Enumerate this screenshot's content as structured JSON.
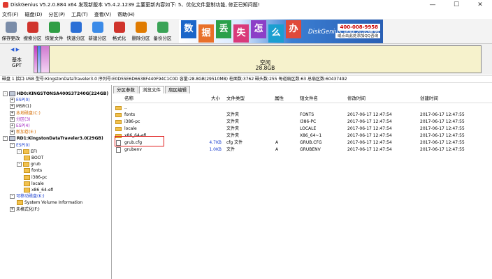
{
  "window": {
    "title": "DiskGenius V5.2.0.884 x64   发现新版本 V5.4.2.1239 主要更新内容如下: 5、优化文件复制功能, 修正已知问题!",
    "min": "—",
    "max": "☐",
    "close": "✕"
  },
  "menu": [
    "文件(F)",
    "磁盘(D)",
    "分区(P)",
    "工具(T)",
    "查看(V)",
    "帮助(H)"
  ],
  "toolbar": [
    {
      "label": "保存更改",
      "icon": "save-icon",
      "color": "#7a8ca8"
    },
    {
      "label": "搜索分区",
      "icon": "search-partition-icon",
      "color": "#d0342c"
    },
    {
      "label": "恢复文件",
      "icon": "recover-file-icon",
      "color": "#2f9e44"
    },
    {
      "label": "快速分区",
      "icon": "quick-partition-icon",
      "color": "#2b6fd6"
    },
    {
      "label": "新建分区",
      "icon": "new-partition-icon",
      "color": "#3b8be8"
    },
    {
      "label": "格式化",
      "icon": "format-icon",
      "color": "#d0342c"
    },
    {
      "label": "删除分区",
      "icon": "delete-partition-icon",
      "color": "#e07b00"
    },
    {
      "label": "备份分区",
      "icon": "backup-partition-icon",
      "color": "#3aa356"
    }
  ],
  "banner": {
    "chars": [
      "数",
      "据",
      "丢",
      "失",
      "怎",
      "么",
      "办"
    ],
    "colors": [
      "#1b66c9",
      "#e8702a",
      "#2aa04a",
      "#d93a7a",
      "#8c3fc7",
      "#1b9fd0",
      "#e04a3a"
    ],
    "slogan": "DiskGenius 团队为您服务",
    "phone": "400-008-9958",
    "qq": "或点击此处添加QQ咨询"
  },
  "disk": {
    "basic": "基本",
    "gpt": "GPT",
    "free_label": "空闲",
    "free_size": "28.8GB"
  },
  "infobar": "磁盘 1 接口:USB  型号:KingstonDataTraveler3.0  序列号:E0D55E6D6638F440F94C1C0D  容量:28.8GB(29510MB)  柱面数:3762  磁头数:255  每道扇区数:63  总扇区数:60437492",
  "tree": [
    {
      "label": "HD0:KINGSTONSA400S37240G(224GB)",
      "cls": "bold",
      "exp": "-",
      "icon": "disk",
      "indent": 0
    },
    {
      "label": "ESP(0)",
      "cls": "blue",
      "exp": "+",
      "icon": "none",
      "indent": 1
    },
    {
      "label": "MSR(1)",
      "cls": "",
      "exp": "+",
      "icon": "none",
      "indent": 1
    },
    {
      "label": "本地磁盘(C:)",
      "cls": "orange",
      "exp": "+",
      "icon": "none",
      "indent": 1
    },
    {
      "label": "分区(3)",
      "cls": "purple",
      "exp": "+",
      "icon": "none",
      "indent": 1
    },
    {
      "label": "ESP(4)",
      "cls": "purple",
      "exp": "+",
      "icon": "none",
      "indent": 1
    },
    {
      "label": "新加卷(E:)",
      "cls": "orange",
      "exp": "+",
      "icon": "none",
      "indent": 1
    },
    {
      "label": "RD1:KingstonDataTraveler3.0(29GB)",
      "cls": "bold",
      "exp": "-",
      "icon": "disk",
      "indent": 0
    },
    {
      "label": "ESP(0)",
      "cls": "blue",
      "exp": "-",
      "icon": "none",
      "indent": 1
    },
    {
      "label": "EFI",
      "cls": "",
      "exp": "-",
      "icon": "folder",
      "indent": 2
    },
    {
      "label": "BOOT",
      "cls": "",
      "exp": "",
      "icon": "folder",
      "indent": 3
    },
    {
      "label": "grub",
      "cls": "",
      "exp": "-",
      "icon": "folder",
      "indent": 2
    },
    {
      "label": "fonts",
      "cls": "",
      "exp": "",
      "icon": "folder",
      "indent": 3
    },
    {
      "label": "i386-pc",
      "cls": "",
      "exp": "",
      "icon": "folder",
      "indent": 3
    },
    {
      "label": "locale",
      "cls": "",
      "exp": "",
      "icon": "folder",
      "indent": 3
    },
    {
      "label": "x86_64-efi",
      "cls": "",
      "exp": "",
      "icon": "folder",
      "indent": 3
    },
    {
      "label": "可移动磁盘(K:)",
      "cls": "blue",
      "exp": "-",
      "icon": "none",
      "indent": 1
    },
    {
      "label": "System Volume Information",
      "cls": "",
      "exp": "",
      "icon": "folder",
      "indent": 2
    },
    {
      "label": "未格式化(F:)",
      "cls": "",
      "exp": "+",
      "icon": "none",
      "indent": 1
    }
  ],
  "tabs": [
    "分区参数",
    "浏览文件",
    "扇区编辑"
  ],
  "columns": [
    "名称",
    "大小",
    "文件类型",
    "属性",
    "短文件名",
    "修改时间",
    "创建时间"
  ],
  "files": [
    {
      "name": "..",
      "size": "",
      "type": "",
      "attr": "",
      "short": "",
      "mtime": "",
      "ctime": "",
      "icon": "folder"
    },
    {
      "name": "fonts",
      "size": "",
      "type": "文件夹",
      "attr": "",
      "short": "FONTS",
      "mtime": "2017-06-17 12:47:54",
      "ctime": "2017-06-17 12:47:55",
      "icon": "folder"
    },
    {
      "name": "i386-pc",
      "size": "",
      "type": "文件夹",
      "attr": "",
      "short": "I386-PC",
      "mtime": "2017-06-17 12:47:54",
      "ctime": "2017-06-17 12:47:55",
      "icon": "folder"
    },
    {
      "name": "locale",
      "size": "",
      "type": "文件夹",
      "attr": "",
      "short": "LOCALE",
      "mtime": "2017-06-17 12:47:54",
      "ctime": "2017-06-17 12:47:55",
      "icon": "folder"
    },
    {
      "name": "x86_64-efi",
      "size": "",
      "type": "文件夹",
      "attr": "",
      "short": "X86_64~1",
      "mtime": "2017-06-17 12:47:54",
      "ctime": "2017-06-17 12:47:55",
      "icon": "folder"
    },
    {
      "name": "grub.cfg",
      "size": "4.7KB",
      "type": "cfg 文件",
      "attr": "A",
      "short": "GRUB.CFG",
      "mtime": "2017-06-17 12:47:54",
      "ctime": "2017-06-17 12:47:55",
      "icon": "doc"
    },
    {
      "name": "grubenv",
      "size": "1.0KB",
      "type": "文件",
      "attr": "A",
      "short": "GRUBENV",
      "mtime": "2017-06-17 12:47:54",
      "ctime": "2017-06-17 12:47:55",
      "icon": "doc"
    }
  ]
}
